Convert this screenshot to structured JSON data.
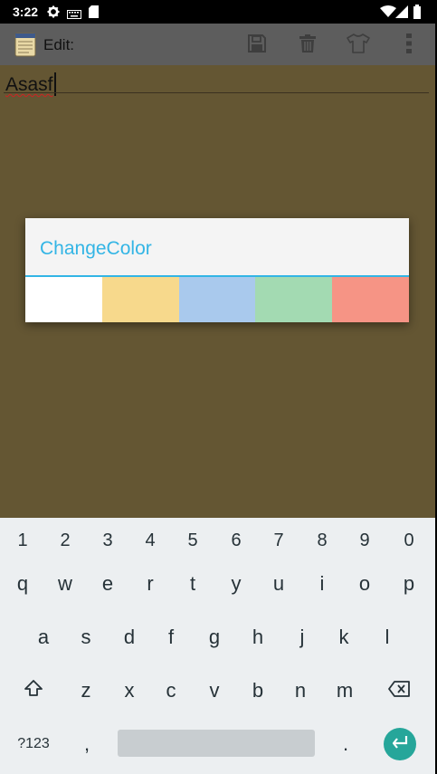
{
  "status_bar": {
    "time": "3:22",
    "icons": [
      "gear-icon",
      "keyboard-icon",
      "sd-card-icon",
      "wifi-icon",
      "cell-signal-icon",
      "battery-icon"
    ]
  },
  "action_bar": {
    "title": "Edit:",
    "app_icon": "notepad-icon",
    "actions": [
      "save-icon",
      "trash-icon",
      "tshirt-icon",
      "overflow-menu-icon"
    ]
  },
  "note": {
    "text": "Asasf"
  },
  "dialog": {
    "title": "ChangeColor",
    "accent": "#33b5e5",
    "swatches": [
      "#ffffff",
      "#f7d98c",
      "#a9c9ed",
      "#a3dab2",
      "#f69485"
    ]
  },
  "keyboard": {
    "number_row": [
      "1",
      "2",
      "3",
      "4",
      "5",
      "6",
      "7",
      "8",
      "9",
      "0"
    ],
    "row1": [
      "q",
      "w",
      "e",
      "r",
      "t",
      "y",
      "u",
      "i",
      "o",
      "p"
    ],
    "row2": [
      "a",
      "s",
      "d",
      "f",
      "g",
      "h",
      "j",
      "k",
      "l"
    ],
    "row3": [
      "z",
      "x",
      "c",
      "v",
      "b",
      "n",
      "m"
    ],
    "symbols_label": "?123",
    "comma": ",",
    "period": ".",
    "enter_color": "#26a69a"
  }
}
